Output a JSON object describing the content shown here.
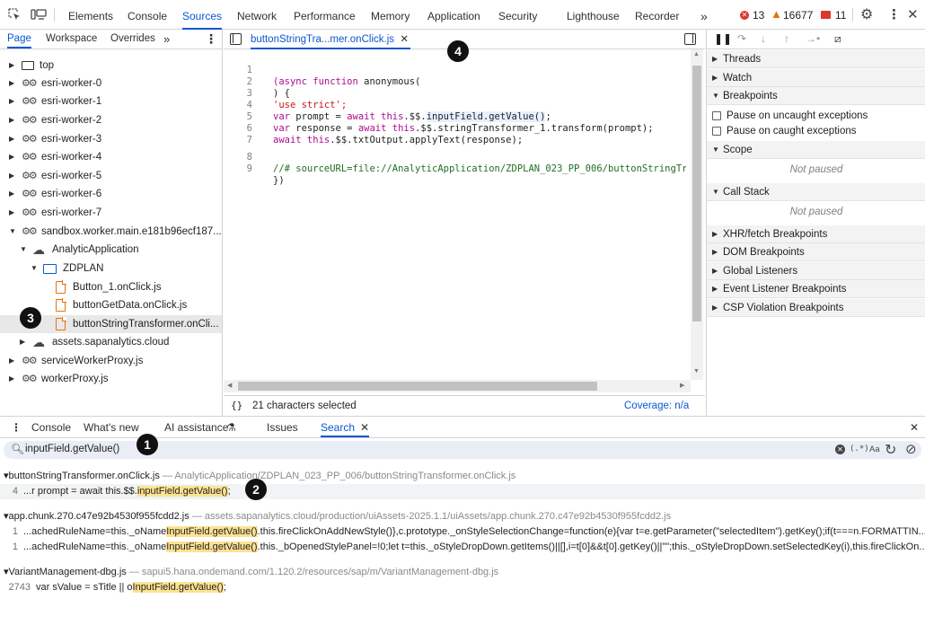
{
  "toolbar": {
    "tabs": [
      "Elements",
      "Console",
      "Sources",
      "Network",
      "Performance",
      "Memory",
      "Application",
      "Security",
      "Lighthouse",
      "Recorder"
    ],
    "active_tab": "Sources",
    "more": "»",
    "errors": "13",
    "warnings": "16677",
    "issues": "11"
  },
  "navigator": {
    "tabs": [
      "Page",
      "Workspace",
      "Overrides"
    ],
    "more": "»",
    "tree": [
      {
        "label": "top"
      },
      {
        "label": "esri-worker-0"
      },
      {
        "label": "esri-worker-1"
      },
      {
        "label": "esri-worker-2"
      },
      {
        "label": "esri-worker-3"
      },
      {
        "label": "esri-worker-4"
      },
      {
        "label": "esri-worker-5"
      },
      {
        "label": "esri-worker-6"
      },
      {
        "label": "esri-worker-7"
      },
      {
        "label": "sandbox.worker.main.e181b96ecf187..."
      },
      {
        "label": "AnalyticApplication"
      },
      {
        "label": "ZDPLAN"
      },
      {
        "label": "Button_1.onClick.js"
      },
      {
        "label": "buttonGetData.onClick.js"
      },
      {
        "label": "buttonStringTransformer.onCli..."
      },
      {
        "label": "assets.sapanalytics.cloud"
      },
      {
        "label": "serviceWorkerProxy.js"
      },
      {
        "label": "workerProxy.js"
      }
    ]
  },
  "editor": {
    "tab_label": "buttonStringTra...mer.onClick.js",
    "lines": [
      {
        "n": "1",
        "text": "(async function anonymous("
      },
      {
        "n": "2",
        "text": ") {"
      },
      {
        "n": "3",
        "text": "'use strict';"
      },
      {
        "n": "4",
        "text": "var prompt = await this.$$.inputField.getValue();"
      },
      {
        "n": "5",
        "text": "var response = await this.$$.stringTransformer_1.transform(prompt);"
      },
      {
        "n": "6",
        "text": "await this.$$.txtOutput.applyText(response);"
      },
      {
        "n": "7",
        "text": ""
      },
      {
        "n": "8",
        "text": "//# sourceURL=file://AnalyticApplication/ZDPLAN_023_PP_006/buttonStringTrans"
      },
      {
        "n": "9",
        "text": "})"
      }
    ],
    "status": "21 characters selected",
    "coverage": "Coverage: n/a"
  },
  "debugger": {
    "sections": {
      "threads": "Threads",
      "watch": "Watch",
      "breakpoints": "Breakpoints",
      "pause_uncaught": "Pause on uncaught exceptions",
      "pause_caught": "Pause on caught exceptions",
      "scope": "Scope",
      "scope_status": "Not paused",
      "call_stack": "Call Stack",
      "call_stack_status": "Not paused",
      "xhr": "XHR/fetch Breakpoints",
      "dom": "DOM Breakpoints",
      "global": "Global Listeners",
      "event": "Event Listener Breakpoints",
      "csp": "CSP Violation Breakpoints"
    }
  },
  "drawer": {
    "tabs": [
      "Console",
      "What's new",
      "AI assistance",
      "Issues",
      "Search"
    ],
    "active_tab": "Search",
    "search_query": "inputField.getValue()",
    "regex": "(.*)",
    "case": "Aa",
    "results": [
      {
        "file": "buttonStringTransformer.onClick.js",
        "path": "AnalyticApplication/ZDPLAN_023_PP_006/buttonStringTransformer.onClick.js",
        "lines": [
          {
            "n": "4",
            "pre": "...r prompt = await this.$$.",
            "match": "inputField.getValue()",
            "post": ";"
          }
        ]
      },
      {
        "file": "app.chunk.270.c47e92b4530f955fcdd2.js",
        "path": "assets.sapanalytics.cloud/production/uiAssets-2025.1.1/uiAssets/app.chunk.270.c47e92b4530f955fcdd2.js",
        "lines": [
          {
            "n": "1",
            "pre": "...achedRuleName=this._oName",
            "match": "InputField.getValue()",
            "post": ".this.fireClickOnAddNewStyle()},c.prototype._onStyleSelectionChange=function(e){var t=e.getParameter(\"selectedItem\").getKey();if(t===n.FORMATTIN..."
          },
          {
            "n": "1",
            "pre": "...achedRuleName=this._oName",
            "match": "InputField.getValue()",
            "post": ".this._bOpenedStylePanel=!0;let t=this._oStyleDropDown.getItems()||[],i=t[0]&&t[0].getKey()||\"\";this._oStyleDropDown.setSelectedKey(i),this.fireClickOn..."
          }
        ]
      },
      {
        "file": "VariantManagement-dbg.js",
        "path": "sapui5.hana.ondemand.com/1.120.2/resources/sap/m/VariantManagement-dbg.js",
        "lines": [
          {
            "n": "2743",
            "pre": "var sValue = sTitle || o",
            "match": "InputField.getValue()",
            "post": ";"
          }
        ]
      }
    ]
  },
  "markers": [
    "1",
    "2",
    "3",
    "4"
  ],
  "colors": {
    "accent": "#0b57d0",
    "error": "#dc362e",
    "warning": "#e37400",
    "match": "#fde293"
  }
}
